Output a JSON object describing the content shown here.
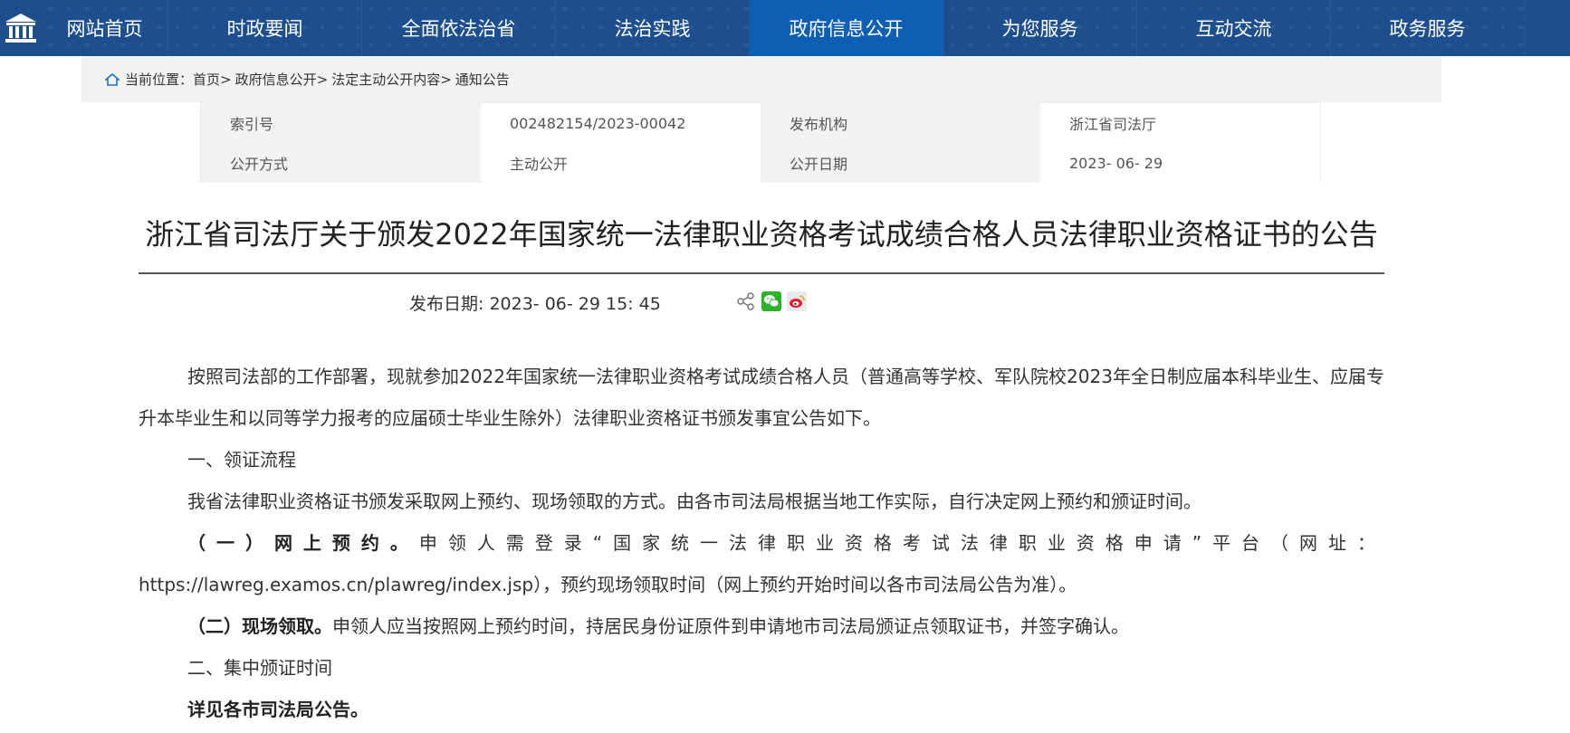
{
  "nav": {
    "items": [
      {
        "label": "网站首页"
      },
      {
        "label": "时政要闻"
      },
      {
        "label": "全面依法治省"
      },
      {
        "label": "法治实践"
      },
      {
        "label": "政府信息公开"
      },
      {
        "label": "为您服务"
      },
      {
        "label": "互动交流"
      },
      {
        "label": "政务服务"
      }
    ],
    "active_index": 4,
    "bg_color": "#1d4f8f",
    "active_color": "#0d5fb4"
  },
  "breadcrumb": {
    "prefix": "当前位置：",
    "items": [
      "首页",
      "政府信息公开",
      "法定主动公开内容",
      "通知公告"
    ],
    "separator": ">"
  },
  "meta": {
    "index_label": "索引号",
    "index_value": "002482154/2023-00042",
    "publisher_label": "发布机构",
    "publisher_value": "浙江省司法厅",
    "method_label": "公开方式",
    "method_value": "主动公开",
    "date_label": "公开日期",
    "date_value": "2023- 06- 29"
  },
  "article": {
    "title": "浙江省司法厅关于颁发2022年国家统一法律职业资格考试成绩合格人员法律职业资格证书的公告",
    "publish_label": "发布日期: ",
    "publish_datetime": "2023- 06- 29 15: 45",
    "share_icons": [
      "share-icon",
      "wechat-icon",
      "weibo-icon"
    ],
    "p1": "按照司法部的工作部署，现就参加2022年国家统一法律职业资格考试成绩合格人员（普通高等学校、军队院校2023年全日制应届本科毕业生、应届专升本毕业生和以同等学力报考的应届硕士毕业生除外）法律职业资格证书颁发事宜公告如下。",
    "h1": "一、领证流程",
    "p2": "我省法律职业资格证书颁发采取网上预约、现场领取的方式。由各市司法局根据当地工作实际，自行决定网上预约和颁证时间。",
    "p3_bold": "（一）网上预约。",
    "p3_rest": "申领人需登录“国家统一法律职业资格考试法律职业资格申请”平台（网址：",
    "p3_url": "https://lawreg.examos.cn/plawreg/index.jsp",
    "p3_tail": "），预约现场领取时间（网上预约开始时间以各市司法局公告为准）。",
    "p4_bold": "（二）现场领取。",
    "p4_rest": "申领人应当按照网上预约时间，持居民身份证原件到申请地市司法局颁证点领取证书，并签字确认。",
    "h2": "二、集中颁证时间",
    "p5_bold": "详见各市司法局公告。"
  }
}
